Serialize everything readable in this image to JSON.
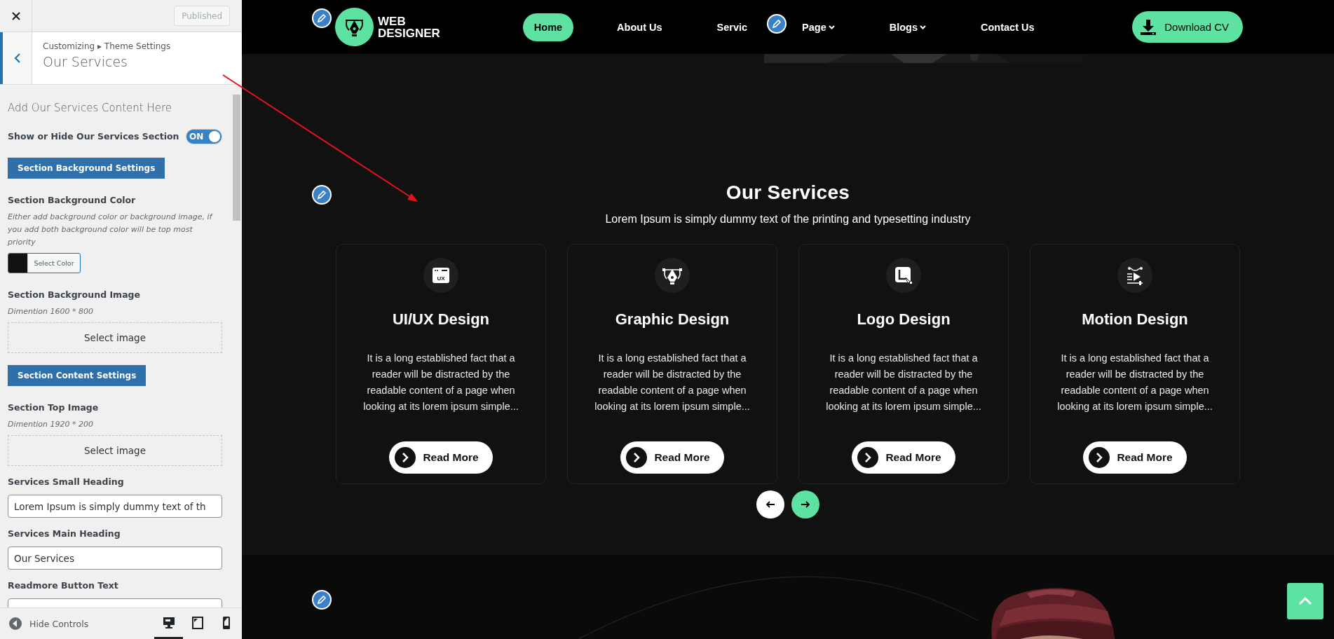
{
  "customizer": {
    "publish_button": {
      "label": "Published",
      "disabled": true
    },
    "breadcrumb": "Customizing ▸ Theme Settings",
    "title": "Our Services",
    "intro": "Add Our Services Content Here",
    "controls": [
      {
        "kind": "toggle",
        "label": "Show or Hide Our Services Section",
        "on": true,
        "state_label": "ON"
      },
      {
        "kind": "section_button",
        "label": "Section Background Settings"
      },
      {
        "kind": "color",
        "label": "Section Background Color",
        "description": "Either add background color or background image, if you add both background color will be top most priority",
        "button": "Select Color"
      },
      {
        "label": "Section Background Image",
        "description": "Dimention 1600 * 800",
        "button": "Select image"
      },
      {
        "kind": "section_button",
        "label": "Section Content Settings"
      },
      {
        "label": "Section Top Image",
        "description": "Dimention 1920 * 200",
        "button": "Select image"
      },
      {
        "kind": "text",
        "label": "Services Small Heading",
        "value": "Lorem Ipsum is simply dummy text of th"
      },
      {
        "kind": "text",
        "label": "Services Main Heading",
        "value": "Our Services"
      },
      {
        "kind": "text",
        "label": "Readmore Button Text"
      }
    ],
    "footer": {
      "hide_label": "Hide Controls",
      "devices": [
        {
          "kind": "desktop",
          "selected": true
        },
        {
          "kind": "tablet",
          "selected": false
        },
        {
          "kind": "mobile",
          "selected": false
        }
      ]
    }
  },
  "site": {
    "logo_lines": [
      "WEB",
      "DESIGNER"
    ],
    "nav": [
      {
        "label": "Home",
        "kind": "link",
        "selected": true
      },
      {
        "label": "About Us",
        "kind": "link",
        "selected": false
      },
      {
        "label": "Servic",
        "kind": "link",
        "selected": false
      },
      {
        "label": "Page",
        "kind": "dropdown",
        "selected": false
      },
      {
        "label": "Blogs",
        "kind": "dropdown",
        "selected": false
      },
      {
        "label": "Contact Us",
        "kind": "link",
        "selected": false
      }
    ],
    "cta": "Download CV",
    "services": {
      "heading": "Our Services",
      "subheading": "Lorem Ipsum is simply dummy text of the printing and typesetting industry",
      "cards": [
        {
          "icon_label": "UX",
          "title": "UI/UX Design",
          "text": "It is a long established fact that a reader will be distracted by the readable content of a page when looking at its lorem ipsum simple...",
          "button": "Read More"
        },
        {
          "title": "Graphic Design",
          "text": "It is a long established fact that a reader will be distracted by the readable content of a page when looking at its lorem ipsum simple...",
          "button": "Read More"
        },
        {
          "title": "Logo Design",
          "text": "It is a long established fact that a reader will be distracted by the readable content of a page when looking at its lorem ipsum simple...",
          "button": "Read More"
        },
        {
          "title": "Motion Design",
          "text": "It is a long established fact that a reader will be distracted by the readable content of a page when looking at its lorem ipsum simple...",
          "button": "Read More"
        }
      ],
      "carousel": [
        {
          "kind": "prev",
          "selected": false
        },
        {
          "kind": "next",
          "selected": true
        }
      ]
    }
  }
}
